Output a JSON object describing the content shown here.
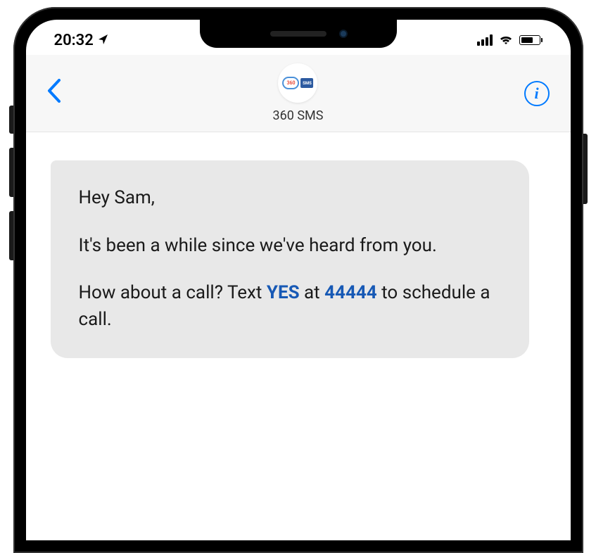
{
  "statusBar": {
    "time": "20:32"
  },
  "header": {
    "contactName": "360 SMS",
    "avatarCloudText": "360",
    "avatarSmsText": "SMS"
  },
  "message": {
    "greeting": "Hey Sam,",
    "body1": "It's been a while since we've heard from you.",
    "body2_part1": "How about a call? Text ",
    "body2_yes": "YES",
    "body2_part2": " at ",
    "body2_number": "44444",
    "body2_part3": " to schedule a call."
  }
}
